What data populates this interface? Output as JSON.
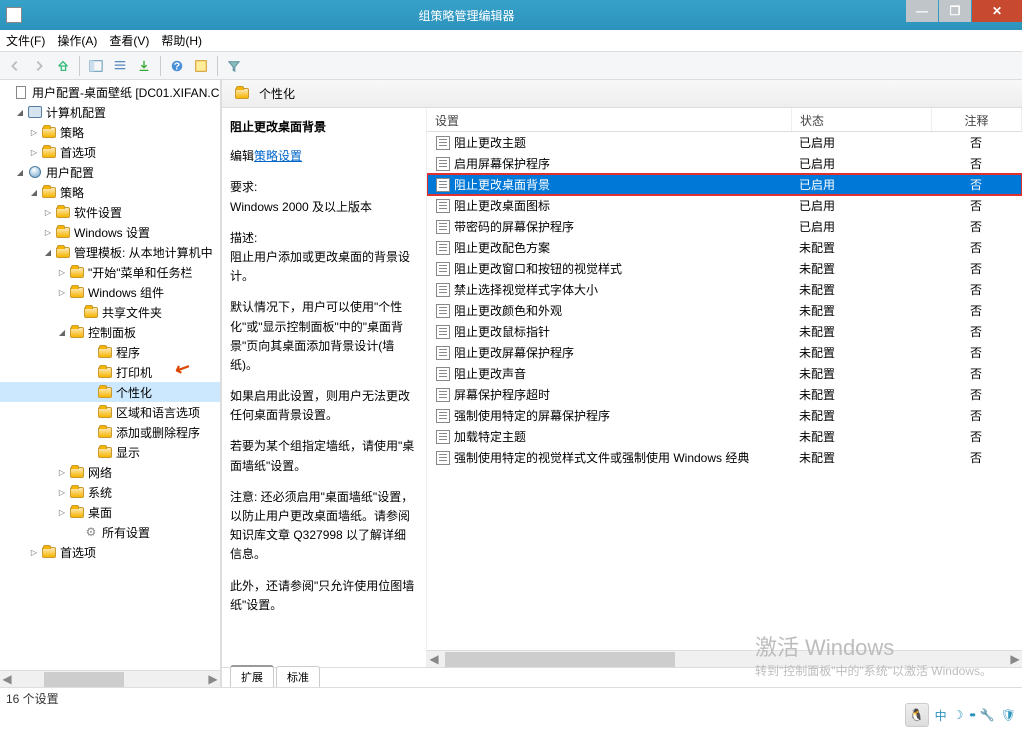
{
  "window": {
    "title": "组策略管理编辑器"
  },
  "menu": {
    "file": "文件(F)",
    "action": "操作(A)",
    "view": "查看(V)",
    "help": "帮助(H)"
  },
  "tree": {
    "root": "用户配置-桌面壁纸 [DC01.XIFAN.C",
    "computer_config": "计算机配置",
    "policy": "策略",
    "preferences": "首选项",
    "user_config": "用户配置",
    "policy2": "策略",
    "software_settings": "软件设置",
    "windows_settings": "Windows 设置",
    "admin_templates": "管理模板: 从本地计算机中",
    "start_taskbar": "\"开始\"菜单和任务栏",
    "windows_components": "Windows 组件",
    "shared_folders": "共享文件夹",
    "control_panel": "控制面板",
    "programs": "程序",
    "printers": "打印机",
    "personalization": "个性化",
    "region_language": "区域和语言选项",
    "add_remove": "添加或删除程序",
    "display": "显示",
    "network": "网络",
    "system": "系统",
    "desktop": "桌面",
    "all_settings": "所有设置",
    "preferences2": "首选项"
  },
  "breadcrumb": {
    "current": "个性化"
  },
  "description": {
    "title": "阻止更改桌面背景",
    "edit_prefix": "编辑",
    "edit_link": "策略设置",
    "req_label": "要求:",
    "req_text": "Windows 2000 及以上版本",
    "desc_label": "描述:",
    "desc_text": "阻止用户添加或更改桌面的背景设计。",
    "para1": "默认情况下，用户可以使用\"个性化\"或\"显示控制面板\"中的\"桌面背景\"页向其桌面添加背景设计(墙纸)。",
    "para2": "如果启用此设置，则用户无法更改任何桌面背景设置。",
    "para3": "若要为某个组指定墙纸，请使用\"桌面墙纸\"设置。",
    "para4": "注意: 还必须启用\"桌面墙纸\"设置，以防止用户更改桌面墙纸。请参阅知识库文章 Q327998 以了解详细信息。",
    "para5": "此外，还请参阅\"只允许使用位图墙纸\"设置。"
  },
  "columns": {
    "setting": "设置",
    "state": "状态",
    "comment": "注释"
  },
  "settings": [
    {
      "name": "阻止更改主题",
      "state": "已启用",
      "comment": "否"
    },
    {
      "name": "启用屏幕保护程序",
      "state": "已启用",
      "comment": "否"
    },
    {
      "name": "阻止更改桌面背景",
      "state": "已启用",
      "comment": "否",
      "selected": true,
      "highlighted": true
    },
    {
      "name": "阻止更改桌面图标",
      "state": "已启用",
      "comment": "否"
    },
    {
      "name": "带密码的屏幕保护程序",
      "state": "已启用",
      "comment": "否"
    },
    {
      "name": "阻止更改配色方案",
      "state": "未配置",
      "comment": "否"
    },
    {
      "name": "阻止更改窗口和按钮的视觉样式",
      "state": "未配置",
      "comment": "否"
    },
    {
      "name": "禁止选择视觉样式字体大小",
      "state": "未配置",
      "comment": "否"
    },
    {
      "name": "阻止更改颜色和外观",
      "state": "未配置",
      "comment": "否"
    },
    {
      "name": "阻止更改鼠标指针",
      "state": "未配置",
      "comment": "否"
    },
    {
      "name": "阻止更改屏幕保护程序",
      "state": "未配置",
      "comment": "否"
    },
    {
      "name": "阻止更改声音",
      "state": "未配置",
      "comment": "否"
    },
    {
      "name": "屏幕保护程序超时",
      "state": "未配置",
      "comment": "否"
    },
    {
      "name": "强制使用特定的屏幕保护程序",
      "state": "未配置",
      "comment": "否"
    },
    {
      "name": "加载特定主题",
      "state": "未配置",
      "comment": "否"
    },
    {
      "name": "强制使用特定的视觉样式文件或强制使用 Windows 经典",
      "state": "未配置",
      "comment": "否"
    }
  ],
  "tabs": {
    "extended": "扩展",
    "standard": "标准"
  },
  "statusbar": {
    "text": "16 个设置"
  },
  "watermark": {
    "title": "激活 Windows",
    "sub": "转到\"控制面板\"中的\"系统\"以激活 Windows。"
  },
  "tray": {
    "ime": "中"
  }
}
